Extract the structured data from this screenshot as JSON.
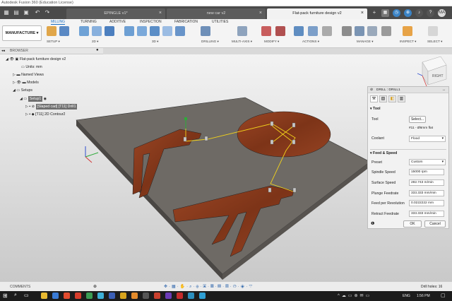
{
  "titlebar": {
    "title": "Autodesk Fusion 360 (Education License)"
  },
  "tabs": [
    {
      "label": "EPINGLE v1*"
    },
    {
      "label": "new car v2"
    },
    {
      "label": "Flat-pack furniture design v2"
    }
  ],
  "user": {
    "initials": "MA"
  },
  "ribbon": {
    "workspace": "MANUFACTURE",
    "tabs": [
      "MILLING",
      "TURNING",
      "ADDITIVE",
      "INSPECTION",
      "FABRICATION",
      "UTILITIES"
    ],
    "groups": [
      "SETUP",
      "2D",
      "3D",
      "DRILLING",
      "MULTI-AXIS",
      "MODIFY",
      "ACTIONS",
      "MANAGE",
      "INSPECT",
      "SELECT"
    ]
  },
  "browser": {
    "header": "BROWSER",
    "root": "Flat-pack furniture design v2",
    "units": "Units: mm",
    "named_views": "Named Views",
    "models": "Models",
    "setups": "Setups",
    "setup1": "Setup1",
    "op1": "[Slaped cad] [T11] Drill1",
    "op2": "[T11] 2D Contour2"
  },
  "drill": {
    "title": "DRILL : DRILL1",
    "tool_section": "Tool",
    "tool_label": "Tool",
    "select_btn": "Select...",
    "tool_value": "#11 - Ø6mm flat",
    "coolant_label": "Coolant",
    "coolant_value": "Flood",
    "fs_section": "Feed & Speed",
    "rows": [
      {
        "label": "Preset",
        "value": "Custom"
      },
      {
        "label": "Spindle Speed",
        "value": "15000 rpm"
      },
      {
        "label": "Surface Speed",
        "value": "282.743 m/min"
      },
      {
        "label": "Plunge Feedrate",
        "value": "333.333 mm/min"
      },
      {
        "label": "Feed per Revolution",
        "value": "0.0222222 mm"
      },
      {
        "label": "Retract Feedrate",
        "value": "333.333 mm/min"
      }
    ],
    "ok": "OK",
    "cancel": "Cancel"
  },
  "viewcube": {
    "face": "RIGHT"
  },
  "comments": {
    "label": "COMMENTS"
  },
  "status": {
    "text": "Drill holes: 16"
  },
  "taskbar": {
    "lang": "ENG",
    "time": "1:56 PM"
  },
  "colors": {
    "accent": "#1b6ec2",
    "wood": "#8a3a1c",
    "plate": "#6e6a65"
  }
}
